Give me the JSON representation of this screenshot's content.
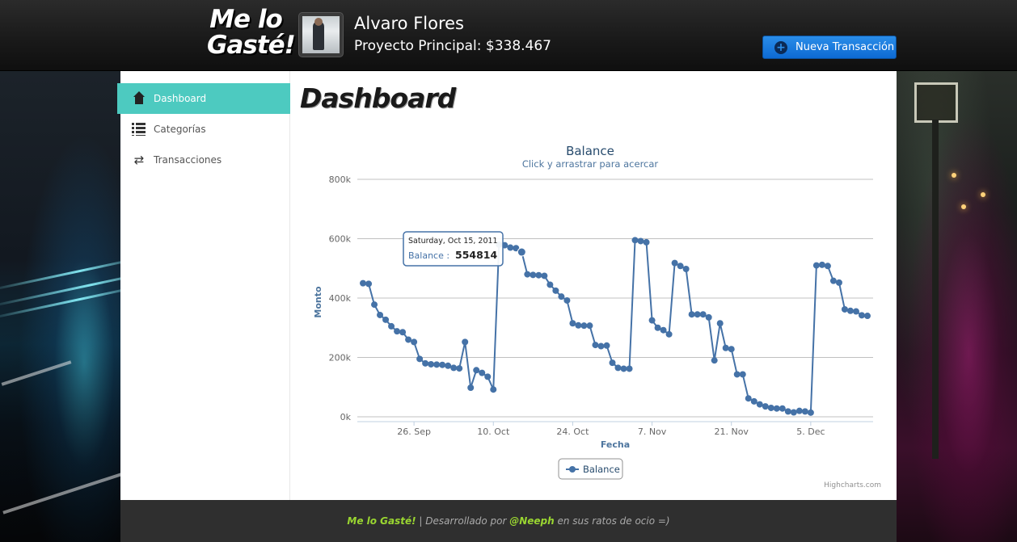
{
  "header": {
    "logo_line1": "Me lo",
    "logo_line2": "Gasté!",
    "user_name": "Alvaro Flores",
    "project_label": "Proyecto Principal: $338.467",
    "new_transaction_label": "Nueva Transacción"
  },
  "sidebar": {
    "items": [
      {
        "label": "Dashboard",
        "icon": "home-icon",
        "active": true
      },
      {
        "label": "Categorías",
        "icon": "list-icon",
        "active": false
      },
      {
        "label": "Transacciones",
        "icon": "swap-icon",
        "active": false
      }
    ]
  },
  "main": {
    "title": "Dashboard"
  },
  "footer": {
    "brand": "Me lo Gasté!",
    "separator": " | Desarrollado por ",
    "author": "@Neeph",
    "suffix": " en sus ratos de ocio =)"
  },
  "colors": {
    "accent": "#4dcac0",
    "series": "#4572a7",
    "button": "#1976d2"
  },
  "chart_data": {
    "type": "line",
    "title": "Balance",
    "subtitle": "Click y arrastrar para acercar",
    "xlabel": "Fecha",
    "ylabel": "Monto",
    "ylim": [
      0,
      800000
    ],
    "y_ticks": [
      "0k",
      "200k",
      "400k",
      "600k",
      "800k"
    ],
    "x_ticks": [
      "26. Sep",
      "10. Oct",
      "24. Oct",
      "7. Nov",
      "21. Nov",
      "5. Dec"
    ],
    "x_tick_days": [
      26,
      40,
      54,
      68,
      82,
      96
    ],
    "legend": "Balance",
    "legend_position": "bottom-center",
    "credits": "Highcharts.com",
    "tooltip": {
      "date": "Saturday, Oct 15, 2011",
      "series": "Balance",
      "value": "554814",
      "day": 45
    },
    "series": [
      {
        "name": "Balance",
        "x": [
          17,
          18,
          19,
          20,
          21,
          22,
          23,
          24,
          25,
          26,
          27,
          28,
          29,
          30,
          31,
          32,
          33,
          34,
          35,
          36,
          37,
          38,
          39,
          40,
          41,
          42,
          43,
          44,
          45,
          46,
          47,
          48,
          49,
          50,
          51,
          52,
          53,
          54,
          55,
          56,
          57,
          58,
          59,
          60,
          61,
          62,
          63,
          64,
          65,
          66,
          67,
          68,
          69,
          70,
          71,
          72,
          73,
          74,
          75,
          76,
          77,
          78,
          79,
          80,
          81,
          82,
          83,
          84,
          85,
          86,
          87,
          88,
          89,
          90,
          91,
          92,
          93,
          94,
          95,
          96,
          97,
          98,
          99,
          100,
          101,
          102,
          103,
          104,
          105,
          106
        ],
        "values": [
          450000,
          448000,
          378000,
          343000,
          327000,
          305000,
          288000,
          285000,
          260000,
          252000,
          195000,
          180000,
          177000,
          176000,
          175000,
          172000,
          165000,
          163000,
          252000,
          98000,
          157000,
          148000,
          135000,
          92000,
          580000,
          578000,
          570000,
          568000,
          555000,
          480000,
          478000,
          477000,
          475000,
          445000,
          425000,
          405000,
          392000,
          315000,
          308000,
          307000,
          307000,
          242000,
          238000,
          240000,
          182000,
          165000,
          162000,
          162000,
          595000,
          592000,
          588000,
          325000,
          300000,
          292000,
          278000,
          518000,
          508000,
          498000,
          345000,
          345000,
          345000,
          335000,
          190000,
          315000,
          232000,
          228000,
          143000,
          143000,
          62000,
          52000,
          42000,
          35000,
          30000,
          28000,
          28000,
          18000,
          15000,
          20000,
          18000,
          14000,
          510000,
          512000,
          508000,
          458000,
          452000,
          362000,
          357000,
          355000,
          342000,
          340000
        ]
      }
    ]
  }
}
